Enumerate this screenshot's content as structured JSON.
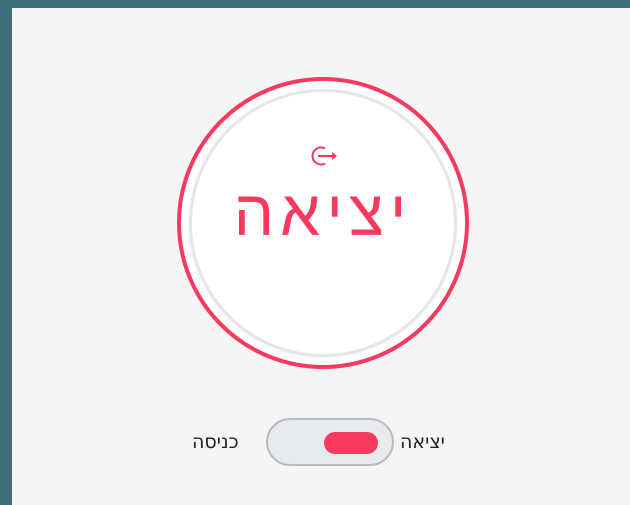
{
  "main_button": {
    "label": "יציאה",
    "icon": "exit-icon",
    "accent_color": "#f6395f"
  },
  "mode_toggle": {
    "left_label": "כניסה",
    "right_label": "יציאה",
    "selected": "יציאה"
  }
}
